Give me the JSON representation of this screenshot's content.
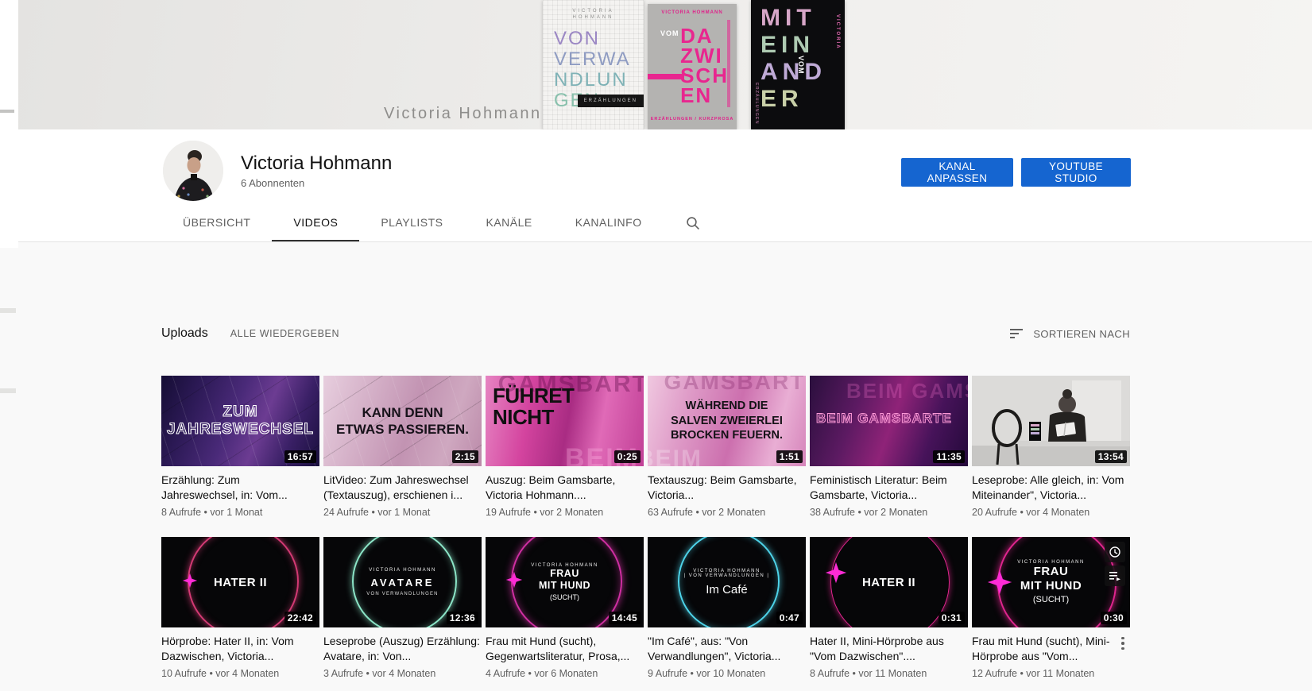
{
  "banner": {
    "channel_text": "Victoria Hohmann",
    "books": [
      {
        "author_lines": [
          "VICTORIA",
          "HOHMANN"
        ],
        "title_lines": [
          "VON",
          "VERWA",
          "NDLUN",
          "GEN"
        ],
        "tag": "ERZÄHLUNGEN"
      },
      {
        "author": "VICTORIA HOHMANN",
        "prefix": "VOM",
        "title_lines": [
          "DA",
          "ZWI",
          "SCH",
          "EN"
        ],
        "footer": "ERZÄHLUNGEN / KURZPROSA"
      },
      {
        "title_lines": [
          "MIT",
          "EIN",
          "AND",
          "ER"
        ],
        "vertical_author": "VICTORIA",
        "vertical_prefix": "VOM",
        "vertical_tag": "ERZÄHLUNGEN"
      }
    ]
  },
  "header": {
    "channel_name": "Victoria Hohmann",
    "subscribers": "6 Abonnenten",
    "buttons": [
      {
        "label": "KANAL ANPASSEN"
      },
      {
        "label": "YOUTUBE STUDIO"
      }
    ]
  },
  "tabs": [
    {
      "label": "ÜBERSICHT",
      "active": false
    },
    {
      "label": "VIDEOS",
      "active": true
    },
    {
      "label": "PLAYLISTS",
      "active": false
    },
    {
      "label": "KANÄLE",
      "active": false
    },
    {
      "label": "KANALINFO",
      "active": false
    }
  ],
  "uploads": {
    "title": "Uploads",
    "play_all_label": "ALLE WIEDERGEBEN",
    "sort_label": "SORTIEREN NACH"
  },
  "videos": [
    {
      "title": "Erzählung: Zum Jahreswechsel, in: Vom...",
      "duration": "16:57",
      "meta": "8 Aufrufe • vor 1 Monat",
      "thumb": {
        "lines": [
          "ZUM JAHRESWECHSEL"
        ]
      }
    },
    {
      "title": "LitVideo: Zum Jahreswechsel (Textauszug), erschienen i...",
      "duration": "2:15",
      "meta": "24 Aufrufe • vor 1 Monat",
      "thumb": {
        "lines": [
          "KANN DENN",
          "ETWAS PASSIEREN."
        ]
      }
    },
    {
      "title": "Auszug: Beim Gamsbarte, Victoria Hohmann....",
      "duration": "0:25",
      "meta": "19 Aufrufe • vor 2 Monaten",
      "thumb": {
        "lines": [
          "FÜHRET",
          "NICHT"
        ],
        "bg_words": [
          "GAMSBARTE",
          "BEIM"
        ]
      }
    },
    {
      "title": "Textauszug: Beim Gamsbarte, Victoria...",
      "duration": "1:51",
      "meta": "63 Aufrufe • vor 2 Monaten",
      "thumb": {
        "lines": [
          "WÄHREND DIE",
          "SALVEN ZWEIERLEI",
          "BROCKEN FEUERN."
        ],
        "bg_words": [
          "GAMSBARTE",
          "BEIM"
        ]
      }
    },
    {
      "title": "Feministisch Literatur: Beim Gamsbarte, Victoria...",
      "duration": "11:35",
      "meta": "38 Aufrufe • vor 2 Monaten",
      "thumb": {
        "lines": [
          "BEIM GAMSBARTE"
        ],
        "bg_words": [
          "BEIM GAMSBARTE"
        ]
      }
    },
    {
      "title": "Leseprobe: Alle gleich, in: Vom Miteinander\", Victoria...",
      "duration": "13:54",
      "meta": "20 Aufrufe • vor 4 Monaten",
      "thumb": {
        "lines": []
      }
    },
    {
      "title": "Hörprobe: Hater II, in: Vom Dazwischen, Victoria...",
      "duration": "22:42",
      "meta": "10 Aufrufe • vor 4 Monaten",
      "thumb": {
        "lines": [
          "HATER II"
        ]
      }
    },
    {
      "title": "Leseprobe (Auszug) Erzählung: Avatare, in: Von...",
      "duration": "12:36",
      "meta": "3 Aufrufe • vor 4 Monaten",
      "thumb": {
        "lines": [
          "VICTORIA HOHMANN",
          "AVATARE",
          "VON VERWANDLUNGEN"
        ]
      }
    },
    {
      "title": "Frau mit Hund (sucht), Gegenwartsliteratur, Prosa,...",
      "duration": "14:45",
      "meta": "4 Aufrufe • vor 6 Monaten",
      "thumb": {
        "lines": [
          "VICTORIA HOHMANN",
          "FRAU",
          "MIT HUND",
          "(SUCHT)"
        ]
      }
    },
    {
      "title": "\"Im Café\", aus: \"Von Verwandlungen\", Victoria...",
      "duration": "0:47",
      "meta": "9 Aufrufe • vor 10 Monaten",
      "thumb": {
        "lines": [
          "VICTORIA HOHMANN",
          "| VON VERWANDLUNGEN |",
          "Im Café"
        ]
      }
    },
    {
      "title": "Hater II, Mini-Hörprobe aus \"Vom Dazwischen\"....",
      "duration": "0:31",
      "meta": "8 Aufrufe • vor 11 Monaten",
      "thumb": {
        "lines": [
          "HATER II"
        ]
      }
    },
    {
      "title": "Frau mit Hund (sucht), Mini-Hörprobe aus \"Vom...",
      "duration": "0:30",
      "meta": "12 Aufrufe • vor 11 Monaten",
      "thumb": {
        "lines": [
          "VICTORIA HOHMANN",
          "FRAU",
          "MIT HUND",
          "(SUCHT)"
        ]
      }
    }
  ],
  "colors": {
    "button_blue": "#1565d0",
    "magenta_ring": "#e0258e",
    "crimson_ring": "#d43a74",
    "teal_ring": "#8ce6c8",
    "cyan_ring": "#4ed4ea",
    "diamond_glow": "#ff2bd6",
    "pink_title": "#e8268f",
    "meta_gray": "#606060"
  },
  "icons": {
    "search-icon": "magnifier",
    "sort-icon": "three shrinking bars",
    "watch-later-icon": "clock",
    "add-to-queue-icon": "playlist add",
    "kebab-icon": "vertical three dots"
  }
}
